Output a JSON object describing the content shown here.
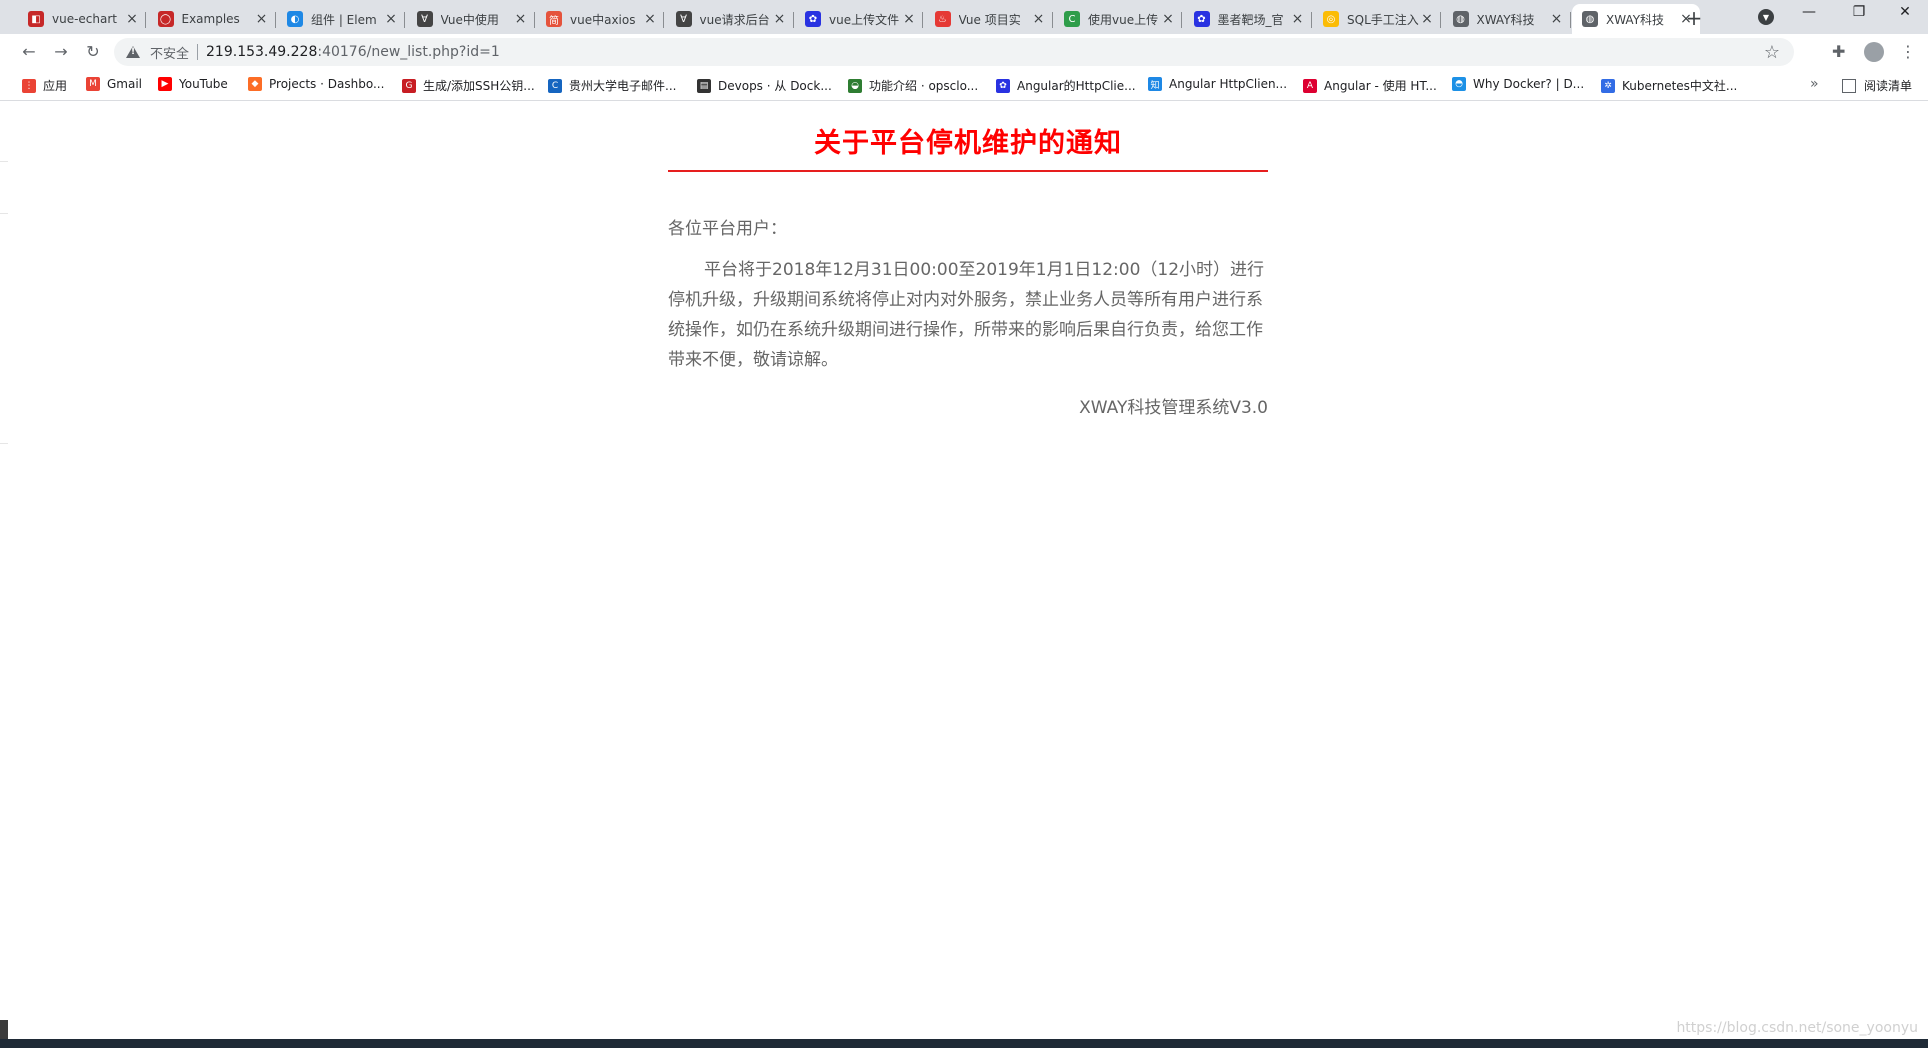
{
  "browser": {
    "tabs": [
      {
        "title": "vue-echart",
        "favicon_color": "#c62828",
        "favicon_glyph": "◧"
      },
      {
        "title": "Examples",
        "favicon_color": "#c62828",
        "favicon_glyph": "◯"
      },
      {
        "title": "组件 | Elem",
        "favicon_color": "#1e88e5",
        "favicon_glyph": "◐"
      },
      {
        "title": "Vue中使用",
        "favicon_color": "#444444",
        "favicon_glyph": "∀"
      },
      {
        "title": "vue中axios",
        "favicon_color": "#e5533c",
        "favicon_glyph": "简"
      },
      {
        "title": "vue请求后台",
        "favicon_color": "#444444",
        "favicon_glyph": "∀"
      },
      {
        "title": "vue上传文件",
        "favicon_color": "#2932e1",
        "favicon_glyph": "✿"
      },
      {
        "title": "Vue 项目实",
        "favicon_color": "#e53935",
        "favicon_glyph": "♨"
      },
      {
        "title": "使用vue上传",
        "favicon_color": "#2e9d4a",
        "favicon_glyph": "C"
      },
      {
        "title": "墨者靶场_官",
        "favicon_color": "#2932e1",
        "favicon_glyph": "✿"
      },
      {
        "title": "SQL手工注入",
        "favicon_color": "#fbbc05",
        "favicon_glyph": "◎"
      },
      {
        "title": "XWAY科技",
        "favicon_color": "#5f6368",
        "favicon_glyph": "◍"
      },
      {
        "title": "XWAY科技",
        "favicon_color": "#5f6368",
        "favicon_glyph": "◍",
        "active": true
      }
    ],
    "address": {
      "security_label": "不安全",
      "host": "219.153.49.228",
      "path": ":40176/new_list.php?id=1"
    },
    "bookmarks": [
      {
        "label": "应用",
        "color": "#ea4335",
        "glyph": "⋮"
      },
      {
        "label": "Gmail",
        "color": "#ea4335",
        "glyph": "M"
      },
      {
        "label": "YouTube",
        "color": "#ff0000",
        "glyph": "▶"
      },
      {
        "label": "Projects · Dashbo...",
        "color": "#fc6d26",
        "glyph": "◆"
      },
      {
        "label": "生成/添加SSH公钥...",
        "color": "#c71d23",
        "glyph": "G"
      },
      {
        "label": "贵州大学电子邮件...",
        "color": "#1565c0",
        "glyph": "C"
      },
      {
        "label": "Devops · 从 Dock...",
        "color": "#333333",
        "glyph": "▤"
      },
      {
        "label": "功能介绍 · opsclo...",
        "color": "#2e7d32",
        "glyph": "◒"
      },
      {
        "label": "Angular的HttpClie...",
        "color": "#2932e1",
        "glyph": "✿"
      },
      {
        "label": "Angular HttpClien...",
        "color": "#1e88e5",
        "glyph": "知"
      },
      {
        "label": "Angular - 使用 HT...",
        "color": "#dd0031",
        "glyph": "A"
      },
      {
        "label": "Why Docker? | D...",
        "color": "#1d91e6",
        "glyph": "◓"
      },
      {
        "label": "Kubernetes中文社...",
        "color": "#326ce5",
        "glyph": "✲"
      }
    ],
    "more_label": "»",
    "reading_list_label": "阅读清单"
  },
  "notice": {
    "title": "关于平台停机维护的通知",
    "greeting": "各位平台用户：",
    "body": "平台将于2018年12月31日00:00至2019年1月1日12:00（12小时）进行停机升级，升级期间系统将停止对内对外服务，禁止业务人员等所有用户进行系统操作，如仍在系统升级期间进行操作，所带来的影响后果自行负责，给您工作带来不便，敬请谅解。",
    "signature": "XWAY科技管理系统V3.0"
  },
  "watermark": "https://blog.csdn.net/sone_yoonyu"
}
